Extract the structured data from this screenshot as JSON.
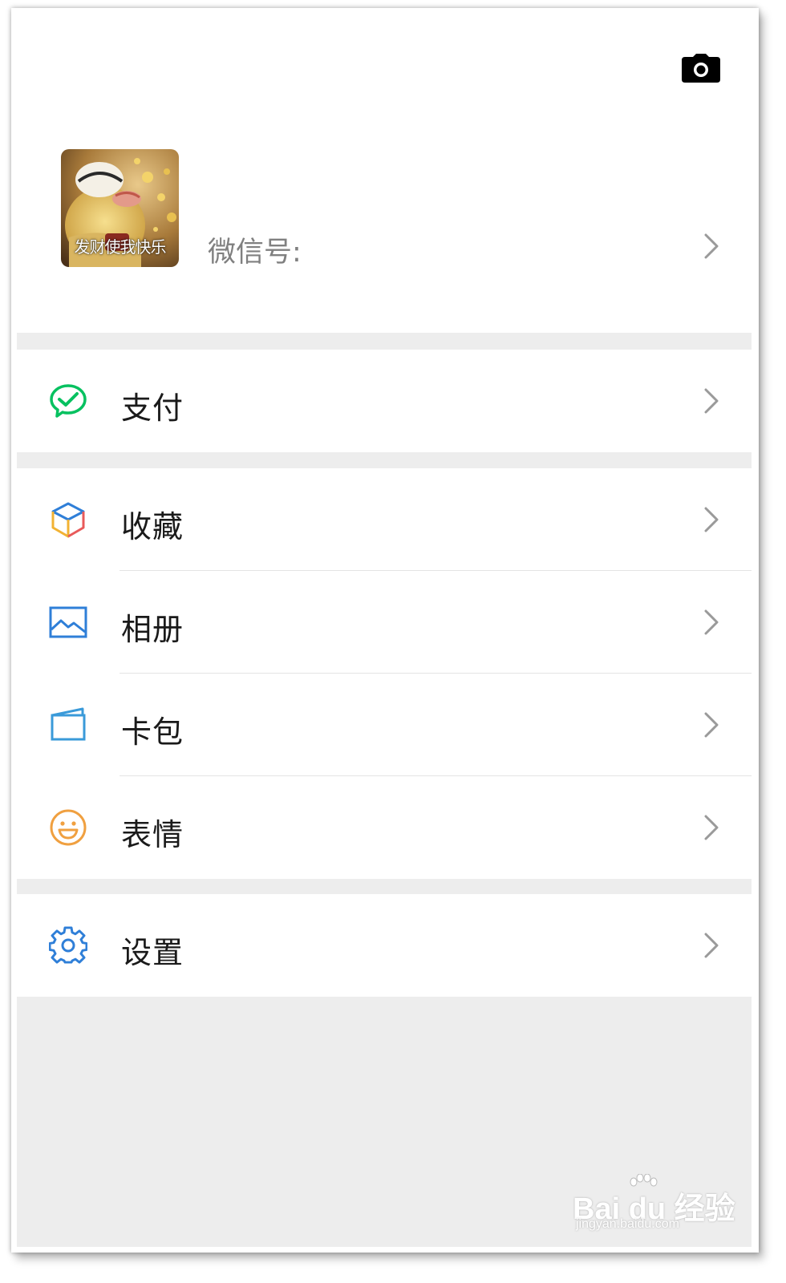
{
  "profile": {
    "avatar_caption": "发财使我快乐",
    "wechat_id_label": "微信号:"
  },
  "menu": {
    "pay": {
      "label": "支付",
      "icon": "wechat-pay-icon"
    },
    "favorites": {
      "label": "收藏",
      "icon": "cube-icon"
    },
    "album": {
      "label": "相册",
      "icon": "image-icon"
    },
    "cards": {
      "label": "卡包",
      "icon": "wallet-icon"
    },
    "stickers": {
      "label": "表情",
      "icon": "smiley-icon"
    },
    "settings": {
      "label": "设置",
      "icon": "gear-icon"
    }
  },
  "watermark": {
    "brand": "Bai du 经验",
    "url": "jingyan.baidu.com"
  },
  "colors": {
    "pay_green": "#07c160",
    "album_blue": "#2f7fd8",
    "cards_blue": "#3a9ad9",
    "smiley_orange": "#f0a040",
    "settings_blue": "#2f7fd8",
    "background": "#ededed"
  }
}
